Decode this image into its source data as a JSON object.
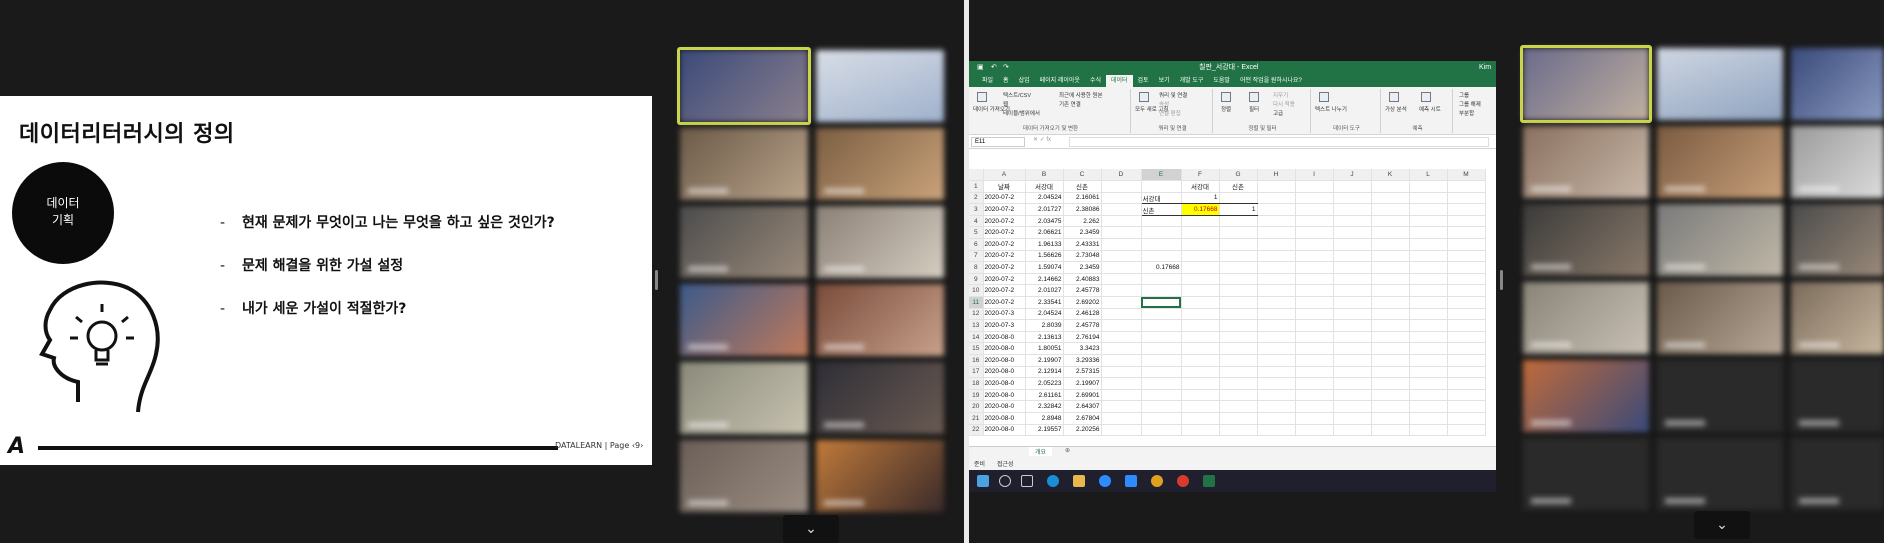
{
  "slide": {
    "title": "데이터리터러시의 정의",
    "circle_line1": "데이터",
    "circle_line2": "기획",
    "bullets": [
      "현재 문제가 무엇이고 나는 무엇을 하고 싶은 것인가?",
      "문제 해결을 위한 가설 설정",
      "내가 세운 가설이 적절한가?"
    ],
    "footer": "DATALEARN  |  Page  ‹9›",
    "logo": "A"
  },
  "colors": {
    "speaker_border": "#c9d64a",
    "excel_green": "#217346",
    "highlight_fill": "#ffff00",
    "highlight_text": "#c00000"
  },
  "excel": {
    "title": "칠판_서강대 - Excel",
    "user": "Kim",
    "menu": [
      "파일",
      "홈",
      "삽입",
      "페이지 레이아웃",
      "수식",
      "데이터",
      "검토",
      "보기",
      "개발 도구",
      "도움말",
      "어떤 작업을 원하시나요?"
    ],
    "ribbon": {
      "get_data": "데이터 가져오기",
      "text_csv": "텍스트/CSV",
      "web": "웹",
      "table_range": "테이블/범위에서",
      "recent_sources": "최근에 사용한 원본",
      "existing_connections": "기존 연결",
      "group1": "데이터 가져오기 및 변환",
      "refresh_all": "모두 새로 고침",
      "queries_connections": "쿼리 및 연결",
      "properties": "속성",
      "edit_links": "연결 편집",
      "group2": "쿼리 및 연결",
      "sort": "정렬",
      "filter": "필터",
      "clear": "지우기",
      "reapply": "다시 적용",
      "advanced": "고급",
      "group3": "정렬 및 필터",
      "text_to_columns": "텍스트 나누기",
      "group4": "데이터 도구",
      "whatif": "가상 분석",
      "forecast_sheet": "예측 시트",
      "group5": "예측",
      "group_outline": "그룹",
      "ungroup": "그룹 해제",
      "subtotal": "부분합"
    },
    "name_box": "E11",
    "columns": [
      "A",
      "B",
      "C",
      "D",
      "E",
      "F",
      "G",
      "H",
      "I",
      "J",
      "K",
      "L",
      "M"
    ],
    "rows": [
      [
        "날짜",
        "서강대",
        "신촌",
        "",
        "",
        "서강대",
        "신촌"
      ],
      [
        "2020-07-2",
        "2.04524",
        "2.16061",
        "",
        "서강대",
        "1",
        ""
      ],
      [
        "2020-07-2",
        "2.01727",
        "2.38086",
        "",
        "신촌",
        "0.17668",
        "1"
      ],
      [
        "2020-07-2",
        "2.03475",
        "2.262",
        "",
        "",
        "",
        ""
      ],
      [
        "2020-07-2",
        "2.06621",
        "2.3459",
        "",
        "",
        "",
        ""
      ],
      [
        "2020-07-2",
        "1.96133",
        "2.43331",
        "",
        "",
        "",
        ""
      ],
      [
        "2020-07-2",
        "1.56626",
        "2.73048",
        "",
        "",
        "",
        ""
      ],
      [
        "2020-07-2",
        "1.59074",
        "2.3459",
        "",
        "0.17668",
        "",
        ""
      ],
      [
        "2020-07-2",
        "2.14662",
        "2.40883",
        "",
        "",
        "",
        ""
      ],
      [
        "2020-07-2",
        "2.01027",
        "2.45778",
        "",
        "",
        "",
        ""
      ],
      [
        "2020-07-2",
        "2.33541",
        "2.69202",
        "",
        "",
        "",
        ""
      ],
      [
        "2020-07-3",
        "2.04524",
        "2.46128",
        "",
        "",
        "",
        ""
      ],
      [
        "2020-07-3",
        "2.8039",
        "2.45778",
        "",
        "",
        "",
        ""
      ],
      [
        "2020-08-0",
        "2.13613",
        "2.76194",
        "",
        "",
        "",
        ""
      ],
      [
        "2020-08-0",
        "1.80051",
        "3.3423",
        "",
        "",
        "",
        ""
      ],
      [
        "2020-08-0",
        "2.19907",
        "3.29336",
        "",
        "",
        "",
        ""
      ],
      [
        "2020-08-0",
        "2.12914",
        "2.57315",
        "",
        "",
        "",
        ""
      ],
      [
        "2020-08-0",
        "2.05223",
        "2.19907",
        "",
        "",
        "",
        ""
      ],
      [
        "2020-08-0",
        "2.61161",
        "2.69901",
        "",
        "",
        "",
        ""
      ],
      [
        "2020-08-0",
        "2.32842",
        "2.64307",
        "",
        "",
        "",
        ""
      ],
      [
        "2020-08-0",
        "2.8948",
        "2.67804",
        "",
        "",
        "",
        ""
      ],
      [
        "2020-08-0",
        "2.19557",
        "2.20256",
        "",
        "",
        "",
        ""
      ]
    ],
    "sheet_tab": "개요",
    "status_left": "준비",
    "status_icon": "접근성"
  },
  "chevron": "⌄"
}
